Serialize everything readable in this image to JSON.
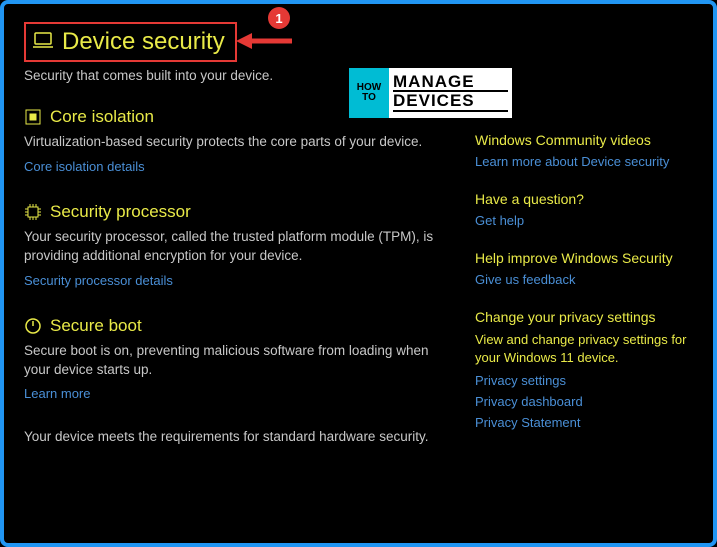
{
  "header": {
    "title": "Device security",
    "subtitle": "Security that comes built into your device."
  },
  "annotation": {
    "number": "1"
  },
  "logo": {
    "left_line1": "HOW",
    "left_line2": "TO",
    "right_line1": "MANAGE",
    "right_line2": "DEVICES"
  },
  "sections": {
    "core_isolation": {
      "title": "Core isolation",
      "desc": "Virtualization-based security protects the core parts of your device.",
      "link": "Core isolation details"
    },
    "security_processor": {
      "title": "Security processor",
      "desc": "Your security processor, called the trusted platform module (TPM), is providing additional encryption for your device.",
      "link": "Security processor details"
    },
    "secure_boot": {
      "title": "Secure boot",
      "desc": "Secure boot is on, preventing malicious software from loading when your device starts up.",
      "link": "Learn more"
    }
  },
  "status": "Your device meets the requirements for standard hardware security.",
  "side": {
    "community": {
      "title": "Windows Community videos",
      "link": "Learn more about Device security"
    },
    "question": {
      "title": "Have a question?",
      "link": "Get help"
    },
    "improve": {
      "title": "Help improve Windows Security",
      "link": "Give us feedback"
    },
    "privacy": {
      "title": "Change your privacy settings",
      "desc": "View and change privacy settings for your Windows 11 device.",
      "link1": "Privacy settings",
      "link2": "Privacy dashboard",
      "link3": "Privacy Statement"
    }
  }
}
